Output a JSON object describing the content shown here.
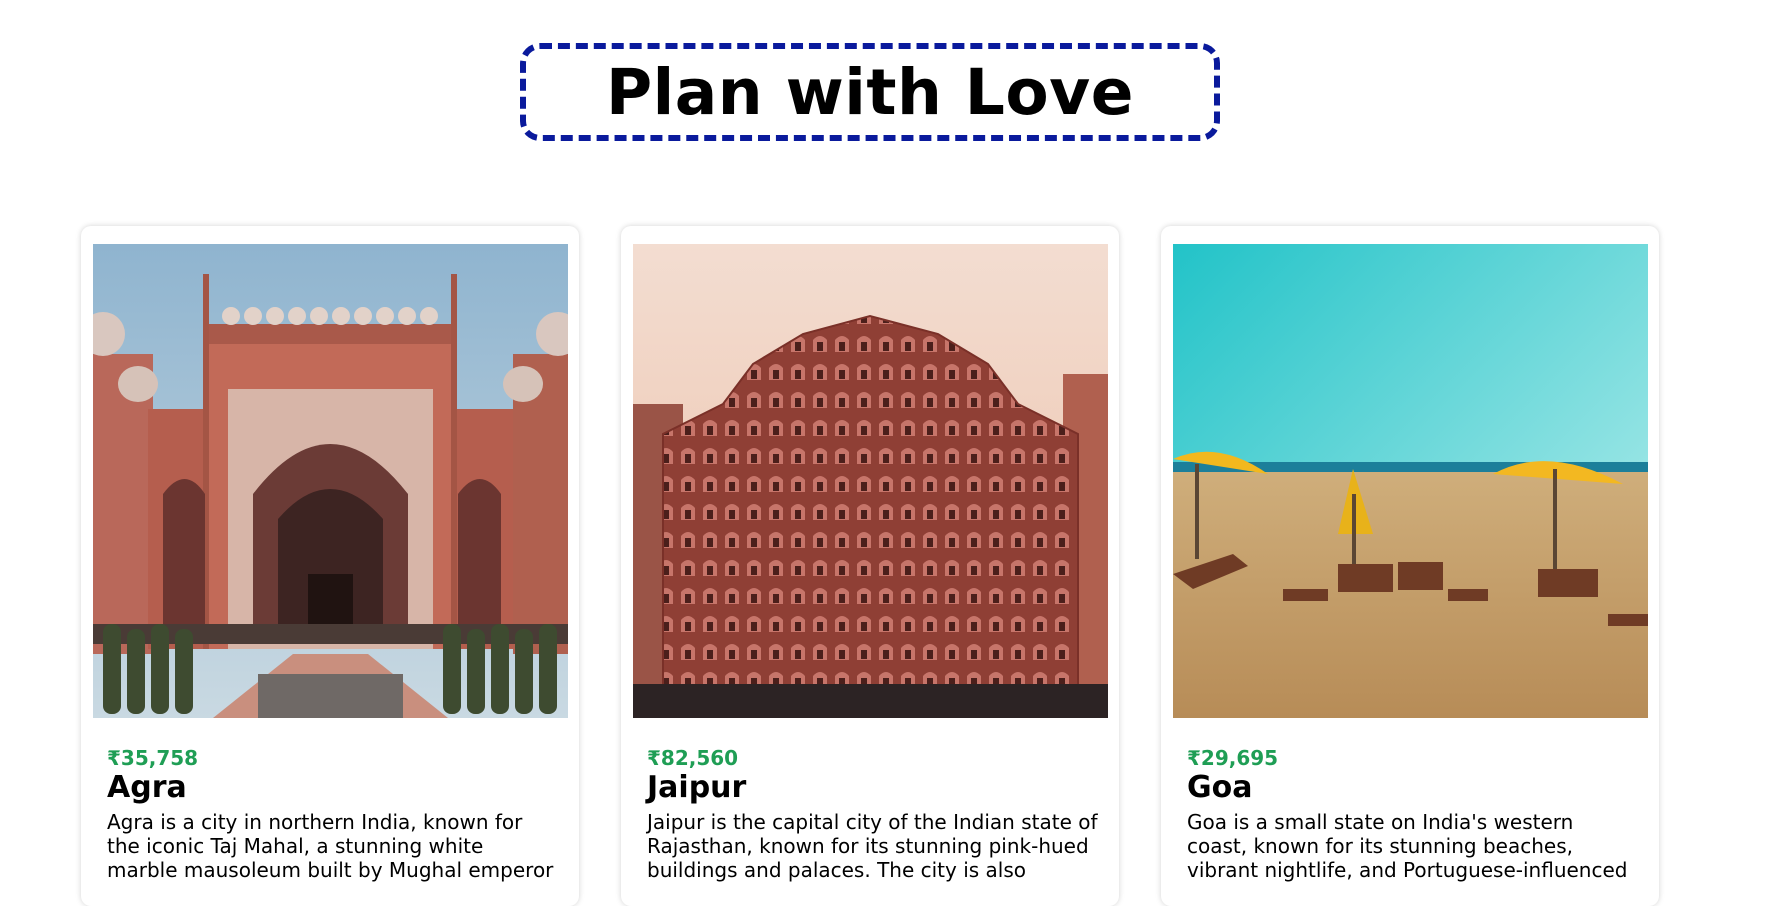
{
  "header": {
    "title": "Plan with Love"
  },
  "cards": [
    {
      "price": "₹35,758",
      "name": "Agra",
      "description": "Agra is a city in northern India, known for the iconic Taj Mahal, a stunning white marble mausoleum built by Mughal emperor",
      "image": "taj-mahal-gate-photo"
    },
    {
      "price": "₹82,560",
      "name": "Jaipur",
      "description": "Jaipur is the capital city of the Indian state of Rajasthan, known for its stunning pink-hued buildings and palaces. The city is also",
      "image": "hawa-mahal-photo"
    },
    {
      "price": "₹29,695",
      "name": "Goa",
      "description": "Goa is a small state on India's western coast, known for its stunning beaches, vibrant nightlife, and Portuguese-influenced",
      "image": "goa-beach-photo"
    }
  ],
  "colors": {
    "price": "#1f9e55",
    "title_border": "#0a1a9c"
  }
}
